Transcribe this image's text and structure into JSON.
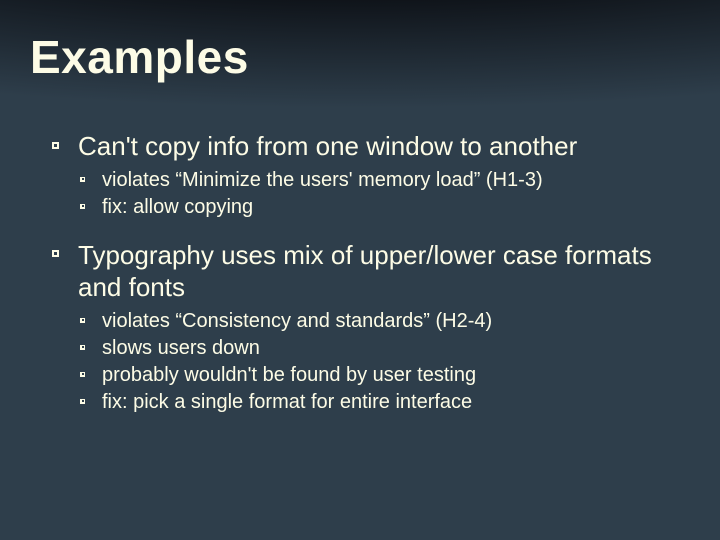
{
  "slide": {
    "title": "Examples",
    "items": [
      {
        "text": "Can't copy info from one window to another",
        "sub": [
          "violates “Minimize the users' memory load” (H1-3)",
          "fix: allow copying"
        ]
      },
      {
        "text": "Typography uses mix of upper/lower case formats and fonts",
        "sub": [
          "violates “Consistency and standards” (H2-4)",
          "slows users down",
          "probably wouldn't be found by user testing",
          "fix: pick a single format for entire interface"
        ]
      }
    ]
  }
}
